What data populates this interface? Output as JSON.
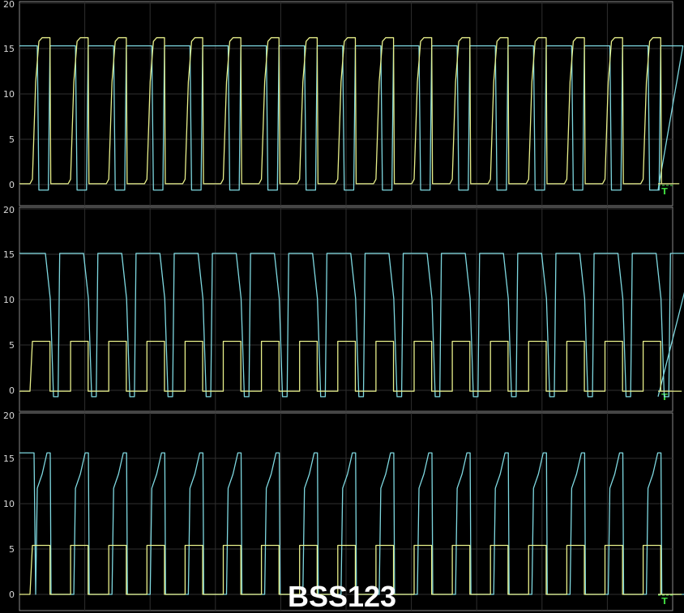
{
  "caption": "BSS123",
  "colors": {
    "background": "#000000",
    "grid": "#2f2f2f",
    "border": "#8a8a8a",
    "channel_a": "#e8f08a",
    "channel_b": "#7ed8e0",
    "trigger_marker": "#3dd23d"
  },
  "trigger_label": "T",
  "chart_data": [
    {
      "type": "line",
      "panel": "top",
      "ylim": [
        0,
        20
      ],
      "y_ticks": [
        "0",
        "5",
        "10",
        "15",
        "20"
      ],
      "grid": true,
      "cycles": 17,
      "series": [
        {
          "values_levels": {
            "low": 0.1,
            "high": 16.2
          }
        },
        {
          "values_levels": {
            "low": -0.6,
            "high": 15.3
          }
        }
      ]
    },
    {
      "type": "line",
      "panel": "middle",
      "ylim": [
        0,
        20
      ],
      "y_ticks": [
        "0",
        "5",
        "10",
        "15",
        "20"
      ],
      "grid": true,
      "cycles": 17,
      "series": [
        {
          "values_levels": {
            "low": -0.1,
            "high": 5.4
          }
        },
        {
          "values_levels": {
            "low": -0.7,
            "high": 15.1
          }
        }
      ]
    },
    {
      "type": "line",
      "panel": "bottom",
      "ylim": [
        0,
        20
      ],
      "y_ticks": [
        "0",
        "5",
        "10",
        "15",
        "20"
      ],
      "grid": true,
      "cycles": 17,
      "series": [
        {
          "values_levels": {
            "low": 0.0,
            "high": 5.4
          }
        },
        {
          "values_levels": {
            "low": 0.0,
            "high": 15.6
          }
        }
      ]
    }
  ]
}
